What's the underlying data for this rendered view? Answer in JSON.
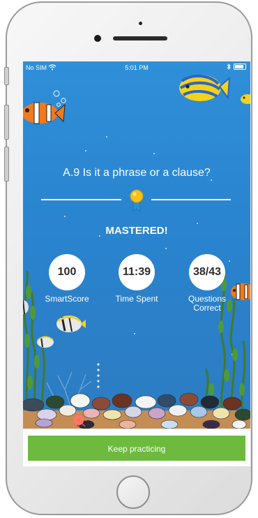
{
  "status_bar": {
    "carrier": "No SIM",
    "time": "5:01 PM",
    "wifi_icon": "wifi-icon",
    "bluetooth_icon": "bluetooth-icon",
    "battery_icon": "battery-icon"
  },
  "result": {
    "skill_title": "A.9 Is it a phrase or a clause?",
    "status": "MASTERED!",
    "medal_icon": "medal-icon"
  },
  "stats": [
    {
      "value": "100",
      "label": "SmartScore"
    },
    {
      "value": "11:39",
      "label": "Time Spent"
    },
    {
      "value": "38/43",
      "label": "Questions Correct"
    }
  ],
  "actions": {
    "keep_practicing_label": "Keep practicing"
  },
  "colors": {
    "water_top": "#2f8fd8",
    "water_bottom": "#2f7cbe",
    "button_green": "#6dba3e",
    "medal_gold": "#f2c21b",
    "ribbon_blue": "#2c8fd6"
  }
}
